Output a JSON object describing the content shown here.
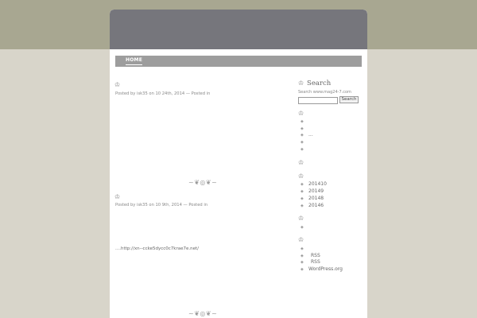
{
  "nav": {
    "home": "HOME"
  },
  "posts": [
    {
      "meta": "Posted by isk35 on 10 24th, 2014 — Posted in"
    },
    {
      "meta": "Posted by isk35 on 10 9th, 2014 — Posted in",
      "link_prefix": "....",
      "link_text": "http://xn--ccke5dycc0c7krae7e.net/"
    }
  ],
  "sidebar": {
    "search_title": "Search",
    "search_note": "Search www.mag24-7.com",
    "search_placeholder": "",
    "search_button": "Search",
    "widget2_items": [
      "",
      "",
      "...",
      "",
      ""
    ],
    "archives": [
      "201410",
      "20149",
      "20148",
      "20146"
    ],
    "widget5_items": [
      ""
    ],
    "meta_items": [
      "",
      "RSS",
      "RSS",
      "WordPress.org"
    ]
  },
  "icons": {
    "ornament": "crown-ornament-icon",
    "divider": "flourish-divider-icon",
    "bullet": "diamond-bullet-icon"
  },
  "colors": {
    "top_band": "#a8a791",
    "background": "#d8d5ca",
    "header": "#76767c",
    "navbar": "#9d9d9d"
  }
}
